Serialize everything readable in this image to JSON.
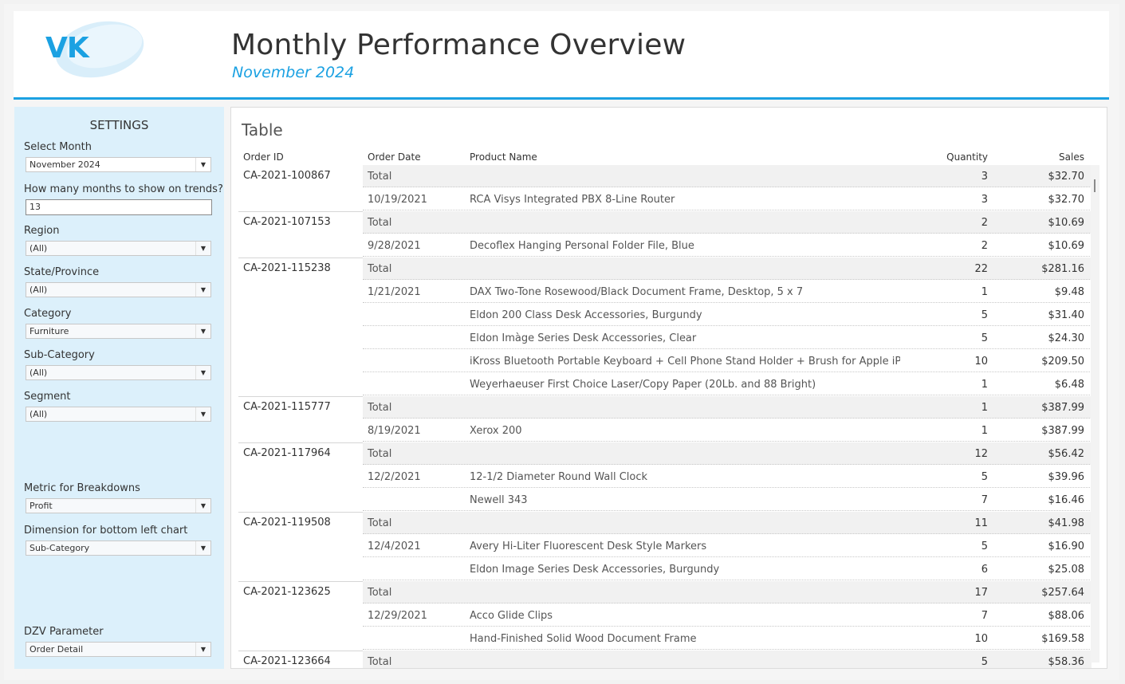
{
  "header": {
    "logo_text": "VK",
    "title": "Monthly Performance Overview",
    "subtitle": "November 2024"
  },
  "colors": {
    "accent": "#1ba1e2",
    "settings_bg": "#dcf0fb",
    "total_row_bg": "#f1f1f1"
  },
  "settings": {
    "title": "SETTINGS",
    "select_month": {
      "label": "Select Month",
      "value": "November 2024"
    },
    "months_trend": {
      "label": "How many months to show on trends?",
      "value": "13"
    },
    "region": {
      "label": "Region",
      "value": "(All)"
    },
    "state": {
      "label": "State/Province",
      "value": "(All)"
    },
    "category": {
      "label": "Category",
      "value": "Furniture"
    },
    "subcategory": {
      "label": "Sub-Category",
      "value": "(All)"
    },
    "segment": {
      "label": "Segment",
      "value": "(All)"
    },
    "metric": {
      "label": "Metric for Breakdowns",
      "value": "Profit"
    },
    "dimension": {
      "label": "Dimension for bottom left chart",
      "value": "Sub-Category"
    },
    "dzv": {
      "label": "DZV Parameter",
      "value": "Order Detail"
    }
  },
  "table": {
    "title": "Table",
    "columns": {
      "order_id": "Order ID",
      "order_date": "Order Date",
      "product_name": "Product Name",
      "quantity": "Quantity",
      "sales": "Sales"
    },
    "rows": [
      {
        "order_id": "CA-2021-100867",
        "date": "Total",
        "product": "",
        "qty": "3",
        "sales": "$32.70",
        "total": true
      },
      {
        "order_id": "",
        "date": "10/19/2021",
        "product": "RCA Visys Integrated PBX 8-Line Router",
        "qty": "3",
        "sales": "$32.70",
        "total": false
      },
      {
        "order_id": "CA-2021-107153",
        "date": "Total",
        "product": "",
        "qty": "2",
        "sales": "$10.69",
        "total": true
      },
      {
        "order_id": "",
        "date": "9/28/2021",
        "product": "Decoflex Hanging Personal Folder File, Blue",
        "qty": "2",
        "sales": "$10.69",
        "total": false
      },
      {
        "order_id": "CA-2021-115238",
        "date": "Total",
        "product": "",
        "qty": "22",
        "sales": "$281.16",
        "total": true
      },
      {
        "order_id": "",
        "date": "1/21/2021",
        "product": "DAX Two-Tone Rosewood/Black Document Frame, Desktop, 5 x 7",
        "qty": "1",
        "sales": "$9.48",
        "total": false
      },
      {
        "order_id": "",
        "date": "",
        "product": "Eldon 200 Class Desk Accessories, Burgundy",
        "qty": "5",
        "sales": "$31.40",
        "total": false
      },
      {
        "order_id": "",
        "date": "",
        "product": "Eldon Imàge Series Desk Accessories, Clear",
        "qty": "5",
        "sales": "$24.30",
        "total": false
      },
      {
        "order_id": "",
        "date": "",
        "product": "iKross Bluetooth Portable Keyboard + Cell Phone Stand Holder + Brush for Apple iPhon..",
        "qty": "10",
        "sales": "$209.50",
        "total": false
      },
      {
        "order_id": "",
        "date": "",
        "product": "Weyerhaeuser First Choice Laser/Copy Paper (20Lb. and 88 Bright)",
        "qty": "1",
        "sales": "$6.48",
        "total": false
      },
      {
        "order_id": "CA-2021-115777",
        "date": "Total",
        "product": "",
        "qty": "1",
        "sales": "$387.99",
        "total": true
      },
      {
        "order_id": "",
        "date": "8/19/2021",
        "product": "Xerox 200",
        "qty": "1",
        "sales": "$387.99",
        "total": false
      },
      {
        "order_id": "CA-2021-117964",
        "date": "Total",
        "product": "",
        "qty": "12",
        "sales": "$56.42",
        "total": true
      },
      {
        "order_id": "",
        "date": "12/2/2021",
        "product": "12-1/2 Diameter Round Wall Clock",
        "qty": "5",
        "sales": "$39.96",
        "total": false
      },
      {
        "order_id": "",
        "date": "",
        "product": "Newell 343",
        "qty": "7",
        "sales": "$16.46",
        "total": false
      },
      {
        "order_id": "CA-2021-119508",
        "date": "Total",
        "product": "",
        "qty": "11",
        "sales": "$41.98",
        "total": true
      },
      {
        "order_id": "",
        "date": "12/4/2021",
        "product": "Avery Hi-Liter Fluorescent Desk Style Markers",
        "qty": "5",
        "sales": "$16.90",
        "total": false
      },
      {
        "order_id": "",
        "date": "",
        "product": "Eldon Image Series Desk Accessories, Burgundy",
        "qty": "6",
        "sales": "$25.08",
        "total": false
      },
      {
        "order_id": "CA-2021-123625",
        "date": "Total",
        "product": "",
        "qty": "17",
        "sales": "$257.64",
        "total": true
      },
      {
        "order_id": "",
        "date": "12/29/2021",
        "product": "Acco Glide Clips",
        "qty": "7",
        "sales": "$88.06",
        "total": false
      },
      {
        "order_id": "",
        "date": "",
        "product": "Hand-Finished Solid Wood Document Frame",
        "qty": "10",
        "sales": "$169.58",
        "total": false
      },
      {
        "order_id": "CA-2021-123664",
        "date": "Total",
        "product": "",
        "qty": "5",
        "sales": "$58.36",
        "total": true
      }
    ]
  }
}
